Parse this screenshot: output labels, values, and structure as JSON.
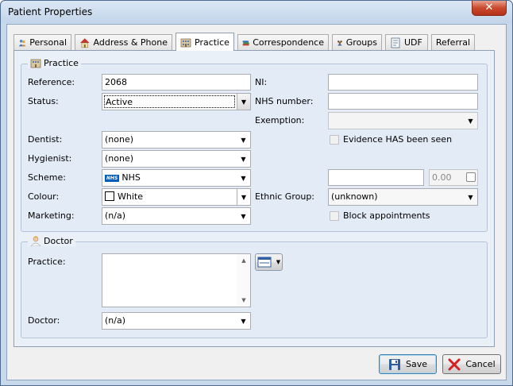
{
  "window": {
    "title": "Patient Properties",
    "close_glyph": "✕"
  },
  "tabs": [
    {
      "label": "Personal",
      "icon": "people-icon"
    },
    {
      "label": "Address & Phone",
      "icon": "house-icon"
    },
    {
      "label": "Practice",
      "icon": "building-icon",
      "active": true
    },
    {
      "label": "Correspondence",
      "icon": "books-icon"
    },
    {
      "label": "Groups",
      "icon": "group-icon"
    },
    {
      "label": "UDF",
      "icon": "document-icon"
    },
    {
      "label": "Referral",
      "icon": ""
    }
  ],
  "practice_group": {
    "title": "Practice",
    "reference_label": "Reference:",
    "reference_value": "2068",
    "status_label": "Status:",
    "status_value": "Active",
    "dentist_label": "Dentist:",
    "dentist_value": "(none)",
    "hygienist_label": "Hygienist:",
    "hygienist_value": "(none)",
    "scheme_label": "Scheme:",
    "scheme_badge": "NHS",
    "scheme_value": "NHS",
    "colour_label": "Colour:",
    "colour_value": "White",
    "marketing_label": "Marketing:",
    "marketing_value": "(n/a)",
    "ni_label": "NI:",
    "ni_value": "",
    "nhs_number_label": "NHS number:",
    "nhs_number_value": "",
    "exemption_label": "Exemption:",
    "exemption_value": "",
    "evidence_label": "Evidence HAS been seen",
    "extra_value": "",
    "amount_value": "0.00",
    "ethnic_label": "Ethnic Group:",
    "ethnic_value": "(unknown)",
    "block_label": "Block appointments"
  },
  "doctor_group": {
    "title": "Doctor",
    "practice_label": "Practice:",
    "practice_value": "",
    "doctor_label": "Doctor:",
    "doctor_value": "(n/a)"
  },
  "buttons": {
    "save": "Save",
    "cancel": "Cancel"
  },
  "colors": {
    "accent": "#3c7fb1",
    "cancel_x": "#d42020",
    "nhs_blue": "#005eb8"
  }
}
